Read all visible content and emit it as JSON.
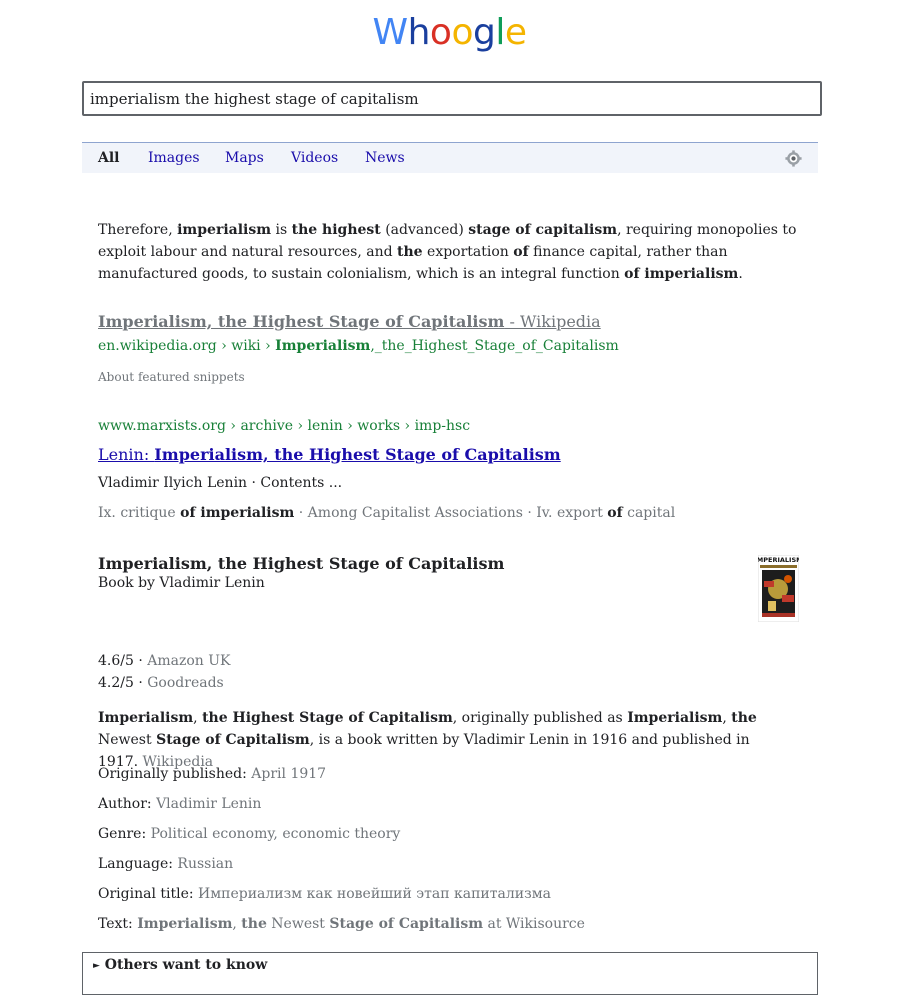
{
  "logo": {
    "letters": [
      {
        "ch": "W",
        "color": "#4285f4"
      },
      {
        "ch": "h",
        "color": "#1a3f9e"
      },
      {
        "ch": "o",
        "color": "#d93025"
      },
      {
        "ch": "o",
        "color": "#f4b400"
      },
      {
        "ch": "g",
        "color": "#1a3f9e"
      },
      {
        "ch": "l",
        "color": "#0f9d58"
      },
      {
        "ch": "e",
        "color": "#f4b400"
      }
    ]
  },
  "search": {
    "value": "imperialism the highest stage of capitalism"
  },
  "nav": {
    "tabs": [
      "All",
      "Images",
      "Maps",
      "Videos",
      "News"
    ],
    "active": "All",
    "settings_icon": "gear-icon"
  },
  "featured": {
    "snippet_parts": [
      {
        "t": "Therefore, ",
        "b": false
      },
      {
        "t": "imperialism",
        "b": true
      },
      {
        "t": " is ",
        "b": false
      },
      {
        "t": "the highest",
        "b": true
      },
      {
        "t": " (advanced) ",
        "b": false
      },
      {
        "t": "stage of capitalism",
        "b": true
      },
      {
        "t": ", requiring monopolies to exploit labour and natural resources, and ",
        "b": false
      },
      {
        "t": "the",
        "b": true
      },
      {
        "t": " exportation ",
        "b": false
      },
      {
        "t": "of",
        "b": true
      },
      {
        "t": " finance capital, rather than manufactured goods, to sustain colonialism, which is an integral function ",
        "b": false
      },
      {
        "t": "of imperialism",
        "b": true
      },
      {
        "t": ".",
        "b": false
      }
    ],
    "title_bold": "Imperialism, the Highest Stage of Capitalism",
    "title_source": " - Wikipedia",
    "url_plain": "en.wikipedia.org › wiki › ",
    "url_bold": "Imperialism",
    "url_rest": ",_the_Highest_Stage_of_Capitalism",
    "about": "About featured snippets"
  },
  "result": {
    "url": "www.marxists.org › archive › lenin › works › imp-hsc",
    "title_prefix": "Lenin: ",
    "title_bold": "Imperialism, the Highest Stage of Capitalism",
    "snippet": "Vladimir Ilyich Lenin · Contents ...",
    "links_parts": [
      {
        "t": "Ix. critique ",
        "b": false
      },
      {
        "t": "of imperialism",
        "b": true
      },
      {
        "t": " · Among Capitalist Associations · Iv. export ",
        "b": false
      },
      {
        "t": "of",
        "b": true
      },
      {
        "t": " capital",
        "b": false
      }
    ]
  },
  "knowledge_panel": {
    "title": "Imperialism, the Highest Stage of Capitalism",
    "subtitle": "Book by Vladimir Lenin",
    "cover_text": "IMPERIALISM",
    "ratings": [
      {
        "score": "4.6/5",
        "source": "Amazon UK"
      },
      {
        "score": "4.2/5",
        "source": "Goodreads"
      }
    ],
    "description_parts": [
      {
        "t": "Imperialism",
        "b": true
      },
      {
        "t": ", ",
        "b": false
      },
      {
        "t": "the Highest Stage of Capitalism",
        "b": true
      },
      {
        "t": ", originally published as ",
        "b": false
      },
      {
        "t": "Imperialism",
        "b": true
      },
      {
        "t": ", ",
        "b": false
      },
      {
        "t": "the",
        "b": true
      },
      {
        "t": " Newest ",
        "b": false
      },
      {
        "t": "Stage of Capitalism",
        "b": true
      },
      {
        "t": ", is a book written by Vladimir Lenin in 1916 and published in 1917. ",
        "b": false
      }
    ],
    "description_source": "Wikipedia",
    "facts": [
      {
        "label": "Originally published: ",
        "value": "April 1917"
      },
      {
        "label": "Author: ",
        "value": "Vladimir Lenin"
      },
      {
        "label": "Genre: ",
        "value": "Political economy, economic theory"
      },
      {
        "label": "Language: ",
        "value": "Russian"
      },
      {
        "label": "Original title: ",
        "value": "Империализм как новейший этап капитализма"
      }
    ],
    "text_fact": {
      "label": "Text: ",
      "parts": [
        {
          "t": "Imperialism",
          "b": true
        },
        {
          "t": ", ",
          "b": false
        },
        {
          "t": "the",
          "b": true
        },
        {
          "t": " Newest ",
          "b": false
        },
        {
          "t": "Stage of Capitalism",
          "b": true
        },
        {
          "t": " at Wikisource",
          "b": false
        }
      ]
    }
  },
  "others": {
    "label": "Others want to know",
    "marker": "►"
  }
}
